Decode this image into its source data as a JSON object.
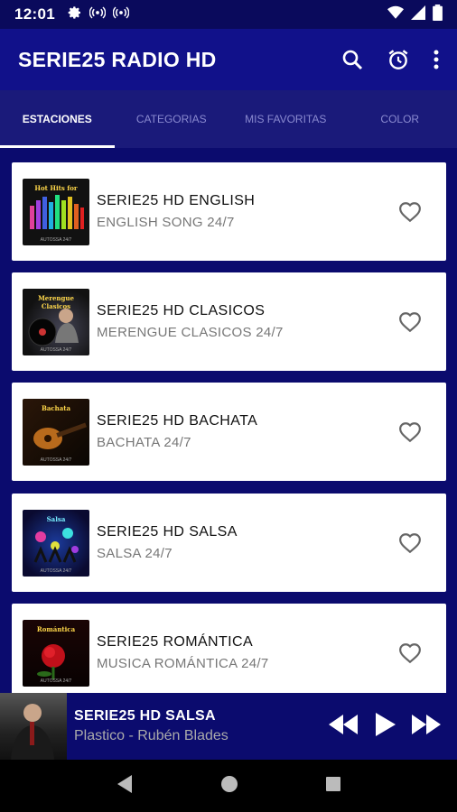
{
  "status": {
    "time": "12:01"
  },
  "app": {
    "title": "SERIE25 RADIO HD"
  },
  "tabs": [
    {
      "label": "ESTACIONES",
      "active": true
    },
    {
      "label": "CATEGORIAS",
      "active": false
    },
    {
      "label": "MIS FAVORITAS",
      "active": false
    },
    {
      "label": "COLOR",
      "active": false
    }
  ],
  "stations": [
    {
      "name": "SERIE25 HD ENGLISH",
      "subtitle": "ENGLISH SONG 24/7",
      "thumb_label": "Hot Hits for",
      "thumb_footer": "AUTOSSA 24/7",
      "icon": "equalizer-art"
    },
    {
      "name": "SERIE25 HD CLASICOS",
      "subtitle": "MERENGUE CLASICOS 24/7",
      "thumb_label": "Merengue Clasicos",
      "thumb_footer": "AUTOSSA 24/7",
      "icon": "vinyl-art"
    },
    {
      "name": "SERIE25 HD BACHATA",
      "subtitle": "BACHATA 24/7",
      "thumb_label": "Bachata",
      "thumb_footer": "AUTOSSA 24/7",
      "icon": "guitar-art"
    },
    {
      "name": "SERIE25 HD SALSA",
      "subtitle": "SALSA 24/7",
      "thumb_label": "Salsa",
      "thumb_footer": "AUTOSSA 24/7",
      "icon": "dancers-art"
    },
    {
      "name": "SERIE25 ROMÁNTICA",
      "subtitle": "MUSICA ROMÁNTICA 24/7",
      "thumb_label": "Romántica",
      "thumb_footer": "AUTOSSA 24/7",
      "icon": "rose-art"
    }
  ],
  "player": {
    "title": "SERIE25 HD SALSA",
    "subtitle": "Plastico - Rubén Blades"
  },
  "colors": {
    "appbar": "#11118a",
    "background": "#0b0b6e",
    "card": "#ffffff"
  }
}
